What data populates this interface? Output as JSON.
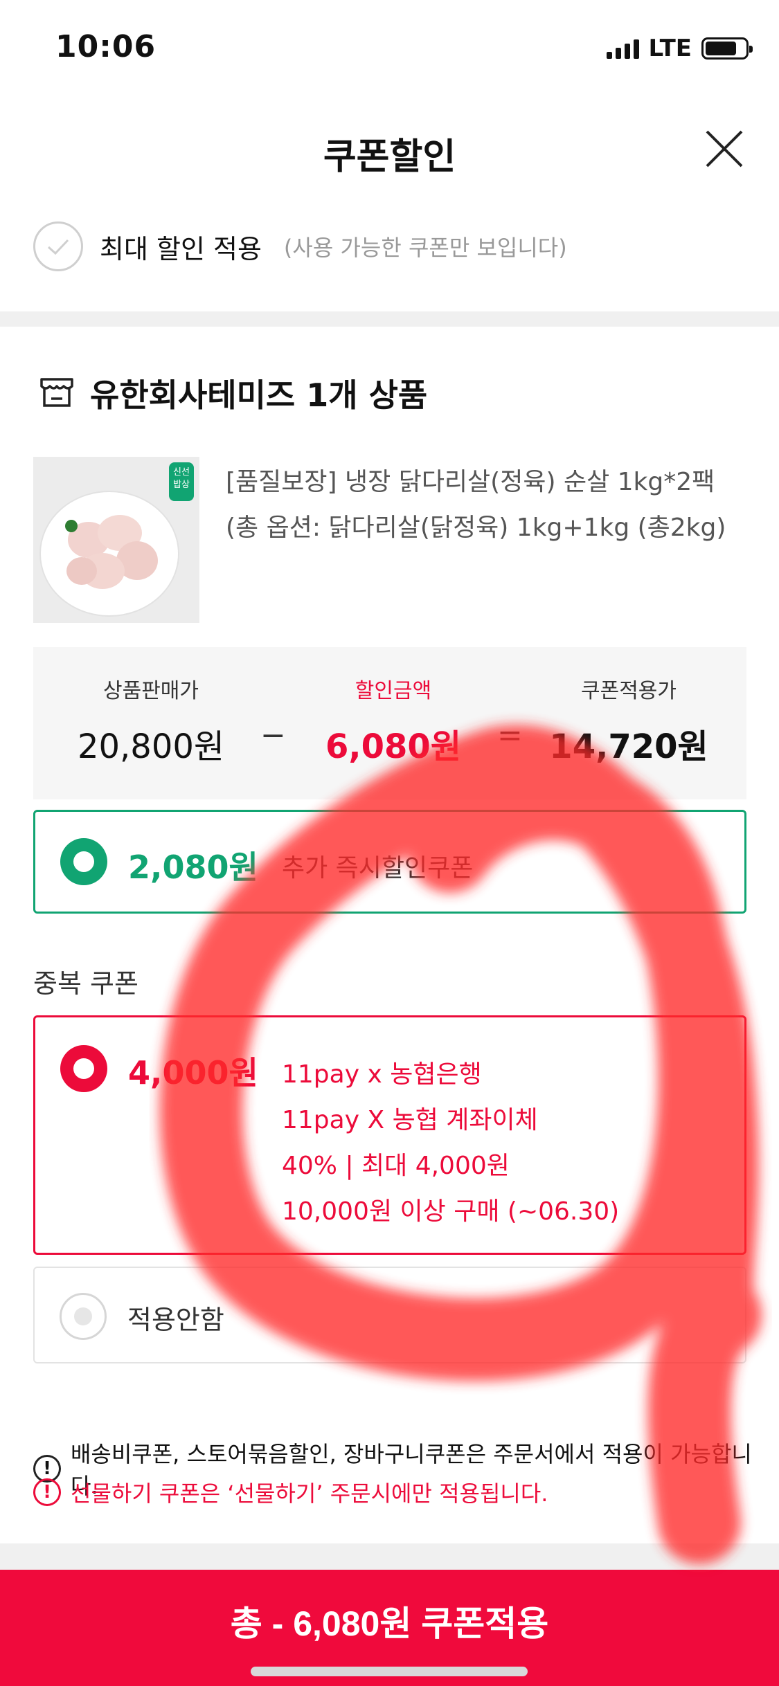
{
  "status_bar": {
    "time": "10:06",
    "network": "LTE"
  },
  "header": {
    "title": "쿠폰할인",
    "close_icon": "close-icon"
  },
  "max_discount": {
    "label": "최대 할인 적용",
    "note": "(사용 가능한 쿠폰만 보입니다)"
  },
  "store": {
    "name": "유한회사테미즈 1개 상품",
    "icon": "store-icon"
  },
  "product": {
    "name": "[품질보장] 냉장 닭다리살(정육) 순살 1kg*2팩 (총 옵션: 닭다리살(닭정육) 1kg+1kg (총2kg)",
    "thumb_badge": "신선 밥상"
  },
  "price": {
    "sale_label": "상품판매가",
    "sale_value": "20,800원",
    "minus": "−",
    "discount_label": "할인금액",
    "discount_value": "6,080원",
    "equals": "=",
    "final_label": "쿠폰적용가",
    "final_value": "14,720원"
  },
  "instant_coupon": {
    "amount": "2,080원",
    "desc": "추가 즉시할인쿠폰"
  },
  "dup_section_title": "중복 쿠폰",
  "dup_coupon": {
    "amount": "4,000원",
    "line1": "11pay x 농협은행",
    "line2": "11pay X 농협 계좌이체",
    "line3": "40% | 최대 4,000원",
    "line4": "10,000원 이상 구매 (~06.30)"
  },
  "no_coupon": {
    "label": "적용안함"
  },
  "notices": {
    "n1": "배송비쿠폰, 스토어묶음할인, 장바구니쿠폰은 주문서에서 적용이 가능합니다.",
    "n2": "선물하기 쿠폰은 ‘선물하기’ 주문시에만 적용됩니다.",
    "icon_glyph": "!"
  },
  "apply_button": {
    "label": "총 - 6,080원 쿠폰적용"
  },
  "colors": {
    "accent_red": "#ec0b3a",
    "accent_green": "#11a472",
    "button_red": "#f00a3c"
  }
}
